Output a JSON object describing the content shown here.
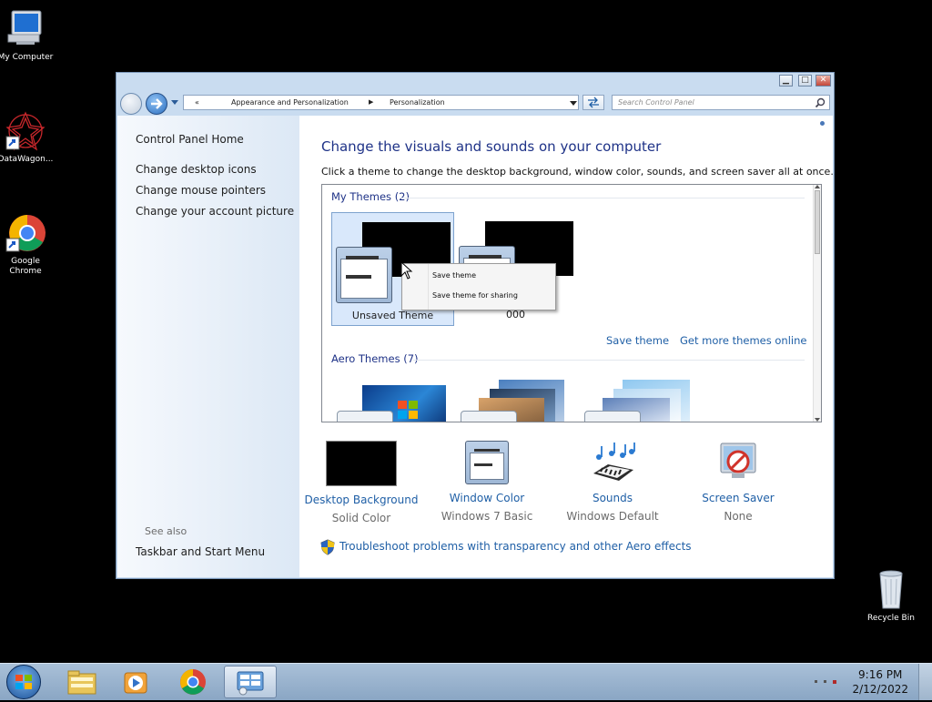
{
  "desktop": {
    "icons": [
      {
        "label": "My Computer"
      },
      {
        "label": "DataWagon..."
      },
      {
        "label": "Google Chrome"
      },
      {
        "label": "Recycle Bin"
      }
    ]
  },
  "window": {
    "breadcrumb": {
      "back_chevron": "«",
      "part1": "Appearance and Personalization",
      "sep": "▶",
      "part2": "Personalization"
    },
    "search_placeholder": "Search Control Panel"
  },
  "left_pane": {
    "home_link": "Control Panel Home",
    "links": [
      "Change desktop icons",
      "Change mouse pointers",
      "Change your account picture"
    ],
    "see_also_label": "See also",
    "see_also_links": [
      "Taskbar and Start Menu"
    ]
  },
  "main": {
    "heading": "Change the visuals and sounds on your computer",
    "subtitle": "Click a theme to change the desktop background, window color, sounds, and screen saver all at once.",
    "my_themes_title": "My Themes (2)",
    "my_themes": [
      {
        "label": "Unsaved Theme",
        "selected": true
      },
      {
        "label": "000",
        "selected": false
      }
    ],
    "save_theme_link": "Save theme",
    "get_more_link": "Get more themes online",
    "aero_title": "Aero Themes (7)",
    "context_menu": [
      "Save theme",
      "Save theme for sharing"
    ],
    "bottom": [
      {
        "label": "Desktop Background",
        "value": "Solid Color",
        "icon": "black-screen-icon"
      },
      {
        "label": "Window Color",
        "value": "Windows 7 Basic",
        "icon": "window-color-icon"
      },
      {
        "label": "Sounds",
        "value": "Windows Default",
        "icon": "sounds-icon"
      },
      {
        "label": "Screen Saver",
        "value": "None",
        "icon": "screen-saver-icon"
      }
    ],
    "troubleshoot_link": "Troubleshoot problems with transparency and other Aero effects"
  },
  "taskbar": {
    "time": "9:16 PM",
    "date": "2/12/2022"
  }
}
